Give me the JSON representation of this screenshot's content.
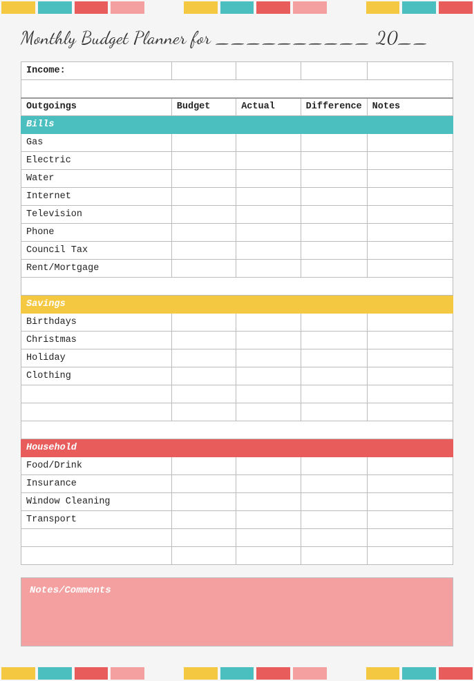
{
  "page": {
    "title": "Monthly Budget Planner for __________ 20__"
  },
  "topBar": {
    "segments": [
      "yellow",
      "teal",
      "red",
      "pink",
      "white",
      "yellow",
      "teal",
      "red",
      "pink",
      "white",
      "yellow",
      "teal",
      "red"
    ]
  },
  "bottomBar": {
    "segments": [
      "yellow",
      "teal",
      "red",
      "pink",
      "white",
      "yellow",
      "teal",
      "red",
      "pink",
      "white",
      "yellow",
      "teal",
      "red"
    ]
  },
  "table": {
    "income_label": "Income:",
    "headers": {
      "outgoings": "Outgoings",
      "budget": "Budget",
      "actual": "Actual",
      "difference": "Difference",
      "notes": "Notes"
    },
    "sections": {
      "bills": "Bills",
      "savings": "Savings",
      "household": "Household"
    },
    "billsRows": [
      "Gas",
      "Electric",
      "Water",
      "Internet",
      "Television",
      "Phone",
      "Council Tax",
      "Rent/Mortgage"
    ],
    "savingsRows": [
      "Birthdays",
      "Christmas",
      "Holiday",
      "Clothing",
      "",
      ""
    ],
    "householdRows": [
      "Food/Drink",
      "Insurance",
      "Window Cleaning",
      "Transport",
      "",
      ""
    ]
  },
  "notes": {
    "label": "Notes/Comments"
  }
}
